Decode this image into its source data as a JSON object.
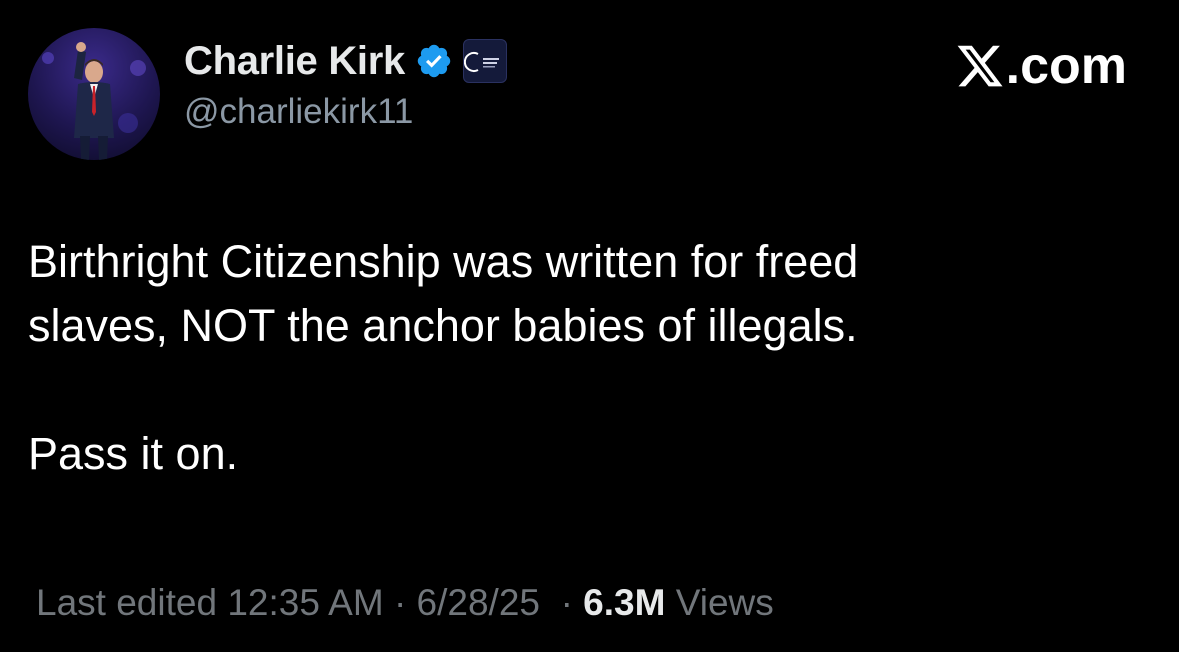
{
  "author": {
    "display_name": "Charlie Kirk",
    "handle": "@charliekirk11",
    "verified": true,
    "verified_badge_color": "#1d9bf0",
    "affiliate_badge_icon": "turning-point-usa-logo-icon",
    "avatar_icon": "profile-photo-avatar"
  },
  "site": {
    "label": ".com",
    "logo_icon": "x-logo-icon"
  },
  "tweet": {
    "line1": "Birthright Citizenship was written for freed",
    "line2": "slaves, NOT the anchor babies of illegals.",
    "line3": "Pass it on."
  },
  "meta": {
    "edited_prefix": "Last edited",
    "time": "12:35 AM",
    "separator": "·",
    "date": "6/28/25",
    "views_count": "6.3M",
    "views_label": "Views"
  },
  "colors": {
    "background": "#000000",
    "primary_text": "#ffffff",
    "secondary_text": "#71767b",
    "accent": "#1d9bf0"
  }
}
